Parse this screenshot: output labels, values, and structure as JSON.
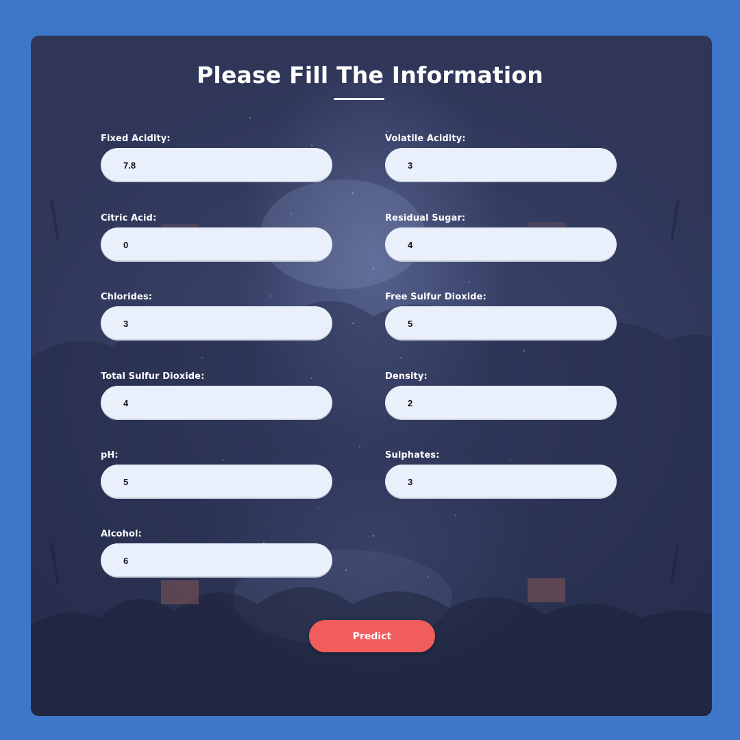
{
  "form": {
    "title": "Please Fill The Information",
    "fields": [
      {
        "label": "Fixed Acidity:",
        "value": "7.8"
      },
      {
        "label": "Volatile Acidity:",
        "value": "3"
      },
      {
        "label": "Citric Acid:",
        "value": "0"
      },
      {
        "label": "Residual Sugar:",
        "value": "4"
      },
      {
        "label": "Chlorides:",
        "value": "3"
      },
      {
        "label": "Free Sulfur Dioxide:",
        "value": "5"
      },
      {
        "label": "Total Sulfur Dioxide:",
        "value": "4"
      },
      {
        "label": "Density:",
        "value": "2"
      },
      {
        "label": "pH:",
        "value": "5"
      },
      {
        "label": "Sulphates:",
        "value": "3"
      },
      {
        "label": "Alcohol:",
        "value": "6"
      }
    ],
    "submit_label": "Predict"
  },
  "colors": {
    "page_background": "#3e77c9",
    "card_background": "#323a5e",
    "input_background": "#e9effb",
    "button": "#f05d5c"
  }
}
